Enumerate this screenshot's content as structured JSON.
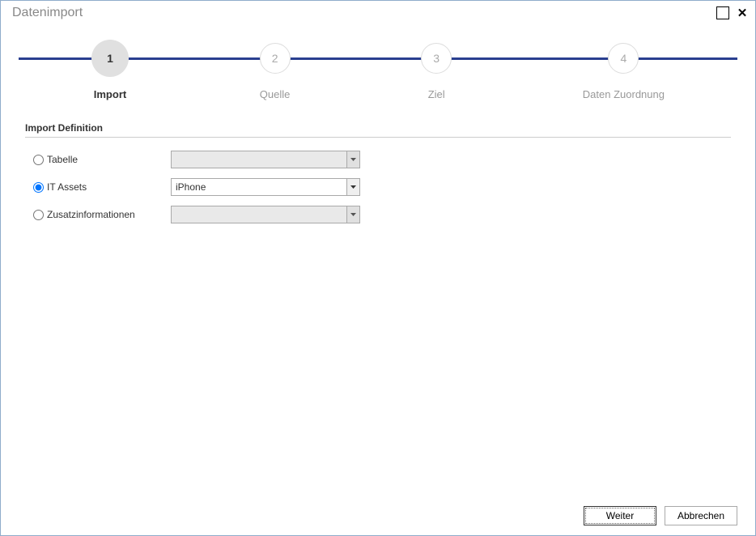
{
  "window": {
    "title": "Datenimport"
  },
  "steps": [
    {
      "number": "1",
      "label": "Import",
      "active": true
    },
    {
      "number": "2",
      "label": "Quelle",
      "active": false
    },
    {
      "number": "3",
      "label": "Ziel",
      "active": false
    },
    {
      "number": "4",
      "label": "Daten Zuordnung",
      "active": false
    }
  ],
  "section": {
    "title": "Import Definition"
  },
  "options": {
    "tabelle": {
      "label": "Tabelle",
      "value": "",
      "selected": false,
      "enabled": false
    },
    "it_assets": {
      "label": "IT Assets",
      "value": "iPhone",
      "selected": true,
      "enabled": true
    },
    "zusatz": {
      "label": "Zusatzinformationen",
      "value": "",
      "selected": false,
      "enabled": false
    }
  },
  "buttons": {
    "next": "Weiter",
    "cancel": "Abbrechen"
  }
}
